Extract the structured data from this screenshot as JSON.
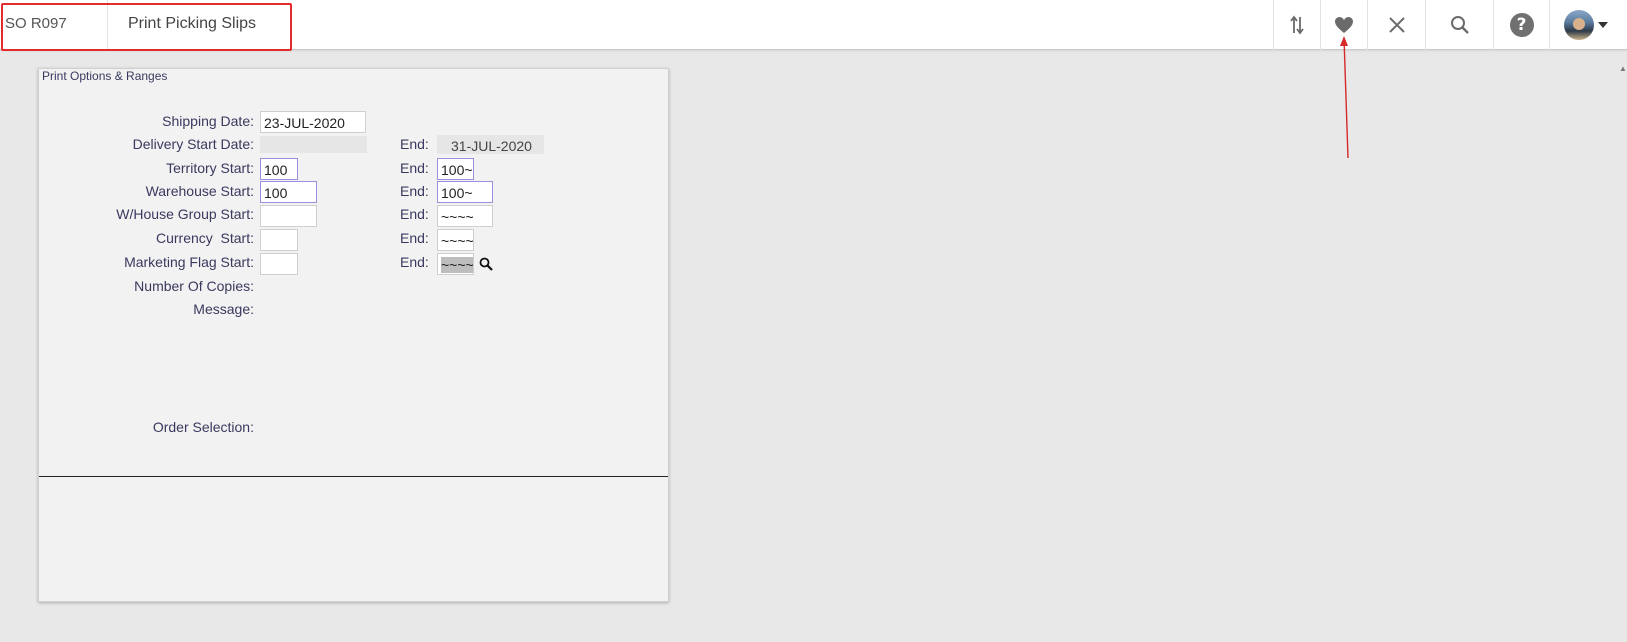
{
  "header": {
    "program_code": "SO R097",
    "program_title": "Print Picking Slips",
    "toolbar": [
      "sort-icon",
      "heart-icon",
      "close-icon",
      "search-icon",
      "help-icon",
      "avatar"
    ],
    "help_glyph": "?"
  },
  "panel": {
    "title": "Print Options & Ranges",
    "end_label": "End:",
    "fields": {
      "shipping_date": {
        "label": "Shipping Date:",
        "value": "23-JUL-2020"
      },
      "delivery_start": {
        "label": "Delivery Start Date:",
        "value": "",
        "end_value": "31-JUL-2020"
      },
      "territory_start": {
        "label": "Territory Start:",
        "value": "100",
        "end_value": "100~"
      },
      "warehouse_start": {
        "label": "Warehouse Start:",
        "value": "100",
        "end_value": "100~"
      },
      "whouse_group_start": {
        "label": "W/House Group Start:",
        "value": "",
        "end_value": "~~~~"
      },
      "currency_start": {
        "label": "Currency  Start:",
        "value": "",
        "end_value": "~~~~"
      },
      "marketing_flag_start": {
        "label": "Marketing Flag Start:",
        "value": "",
        "end_value": "~~~~"
      },
      "number_of_copies": {
        "label": "Number Of Copies:"
      },
      "message": {
        "label": "Message:"
      },
      "order_selection": {
        "label": "Order Selection:"
      }
    }
  },
  "colors": {
    "highlight_box": "#e32b2b",
    "label_text": "#39395f",
    "active_field_border": "#9b8fe0"
  }
}
